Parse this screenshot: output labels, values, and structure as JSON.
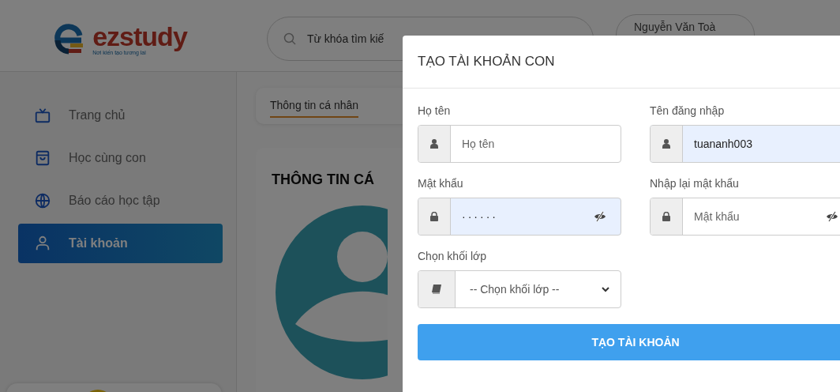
{
  "header": {
    "logo": {
      "name": "ezstudy",
      "tagline": "Nơi kiến tạo tương lai"
    },
    "search": {
      "placeholder": "Từ khóa tìm kiế"
    },
    "user": "Nguyễn Văn Toà"
  },
  "sidebar": {
    "items": [
      {
        "label": "Trang chủ",
        "selected": false
      },
      {
        "label": "Học cùng con",
        "selected": false
      },
      {
        "label": "Báo cáo học tập",
        "selected": false
      },
      {
        "label": "Tài khoản",
        "selected": true
      }
    ]
  },
  "main": {
    "tabs": [
      {
        "label": "Thông tin cá nhân",
        "selected": true
      }
    ],
    "card_title": "THÔNG TIN CÁ"
  },
  "modal": {
    "title": "TẠO TÀI KHOẢN CON",
    "fields": [
      {
        "kind": "text",
        "label": "Họ tên",
        "placeholder": "Họ tên",
        "autofilled": false
      },
      {
        "kind": "text",
        "label": "Tên đăng nhập",
        "value": "tuananh003",
        "autofilled": true
      },
      {
        "kind": "password",
        "label": "Mật khẩu",
        "value": "······",
        "autofilled": true
      },
      {
        "kind": "password",
        "label": "Nhập lại mật khẩu",
        "placeholder": "Mật khẩu",
        "autofilled": false
      },
      {
        "kind": "select",
        "label": "Chọn khối lớp",
        "value": "-- Chọn khối lớp --",
        "autofilled": false
      }
    ],
    "submit": "TẠO TÀI KHOẢN"
  }
}
